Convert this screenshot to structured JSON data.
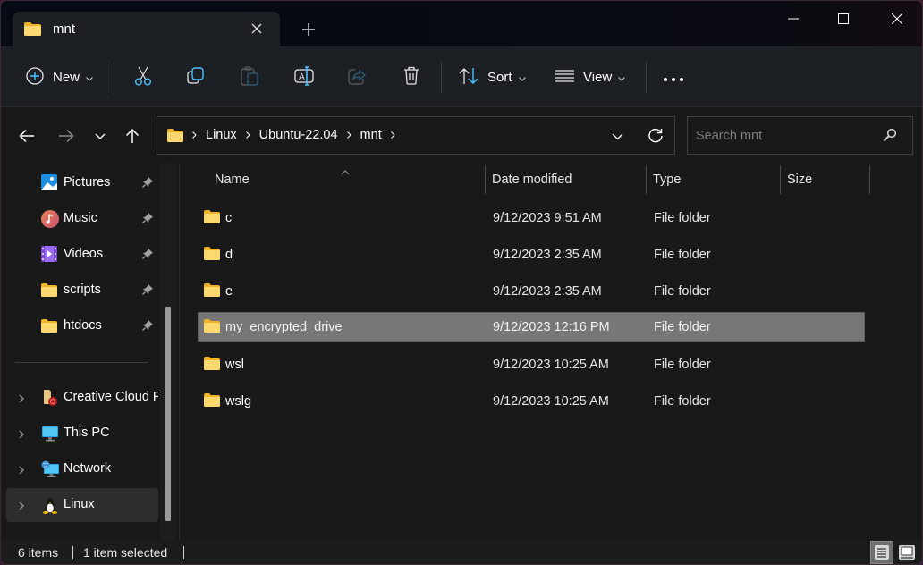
{
  "window": {
    "tab_title": "mnt",
    "controls": {
      "minimize": "minimize",
      "maximize": "maximize",
      "close": "close"
    }
  },
  "toolbar": {
    "new_label": "New",
    "sort_label": "Sort",
    "view_label": "View",
    "icons": [
      "plus-circle-icon",
      "cut-icon",
      "copy-icon",
      "paste-icon",
      "rename-icon",
      "share-icon",
      "delete-icon",
      "sort-icon",
      "view-icon",
      "more-icon"
    ]
  },
  "address": {
    "crumbs": [
      "Linux",
      "Ubuntu-22.04",
      "mnt"
    ],
    "search_placeholder": "Search mnt",
    "search_value": ""
  },
  "sidebar": {
    "quick_access": [
      {
        "label": "Pictures",
        "icon": "pictures-icon",
        "pinned": true
      },
      {
        "label": "Music",
        "icon": "music-icon",
        "pinned": true
      },
      {
        "label": "Videos",
        "icon": "videos-icon",
        "pinned": true
      },
      {
        "label": "scripts",
        "icon": "folder-icon",
        "pinned": true
      },
      {
        "label": "htdocs",
        "icon": "folder-icon",
        "pinned": true
      }
    ],
    "locations": [
      {
        "label": "Creative Cloud Files",
        "icon": "creative-cloud-icon",
        "expandable": true
      },
      {
        "label": "This PC",
        "icon": "this-pc-icon",
        "expandable": true
      },
      {
        "label": "Network",
        "icon": "network-icon",
        "expandable": true
      },
      {
        "label": "Linux",
        "icon": "linux-icon",
        "expandable": true,
        "selected": true
      }
    ]
  },
  "filelist": {
    "columns": [
      "Name",
      "Date modified",
      "Type",
      "Size"
    ],
    "sorted_by": "Name",
    "rows": [
      {
        "name": "c",
        "date": "9/12/2023 9:51 AM",
        "type": "File folder",
        "size": "",
        "selected": false
      },
      {
        "name": "d",
        "date": "9/12/2023 2:35 AM",
        "type": "File folder",
        "size": "",
        "selected": false
      },
      {
        "name": "e",
        "date": "9/12/2023 2:35 AM",
        "type": "File folder",
        "size": "",
        "selected": false
      },
      {
        "name": "my_encrypted_drive",
        "date": "9/12/2023 12:16 PM",
        "type": "File folder",
        "size": "",
        "selected": true
      },
      {
        "name": "wsl",
        "date": "9/12/2023 10:25 AM",
        "type": "File folder",
        "size": "",
        "selected": false
      },
      {
        "name": "wslg",
        "date": "9/12/2023 10:25 AM",
        "type": "File folder",
        "size": "",
        "selected": false
      }
    ]
  },
  "status": {
    "item_count": "6 items",
    "selection": "1 item selected",
    "active_view": "details"
  },
  "colors": {
    "accent": "#4cc2ff",
    "folder": "#f8d775",
    "selected_row": "#777777",
    "background": "#191919"
  }
}
